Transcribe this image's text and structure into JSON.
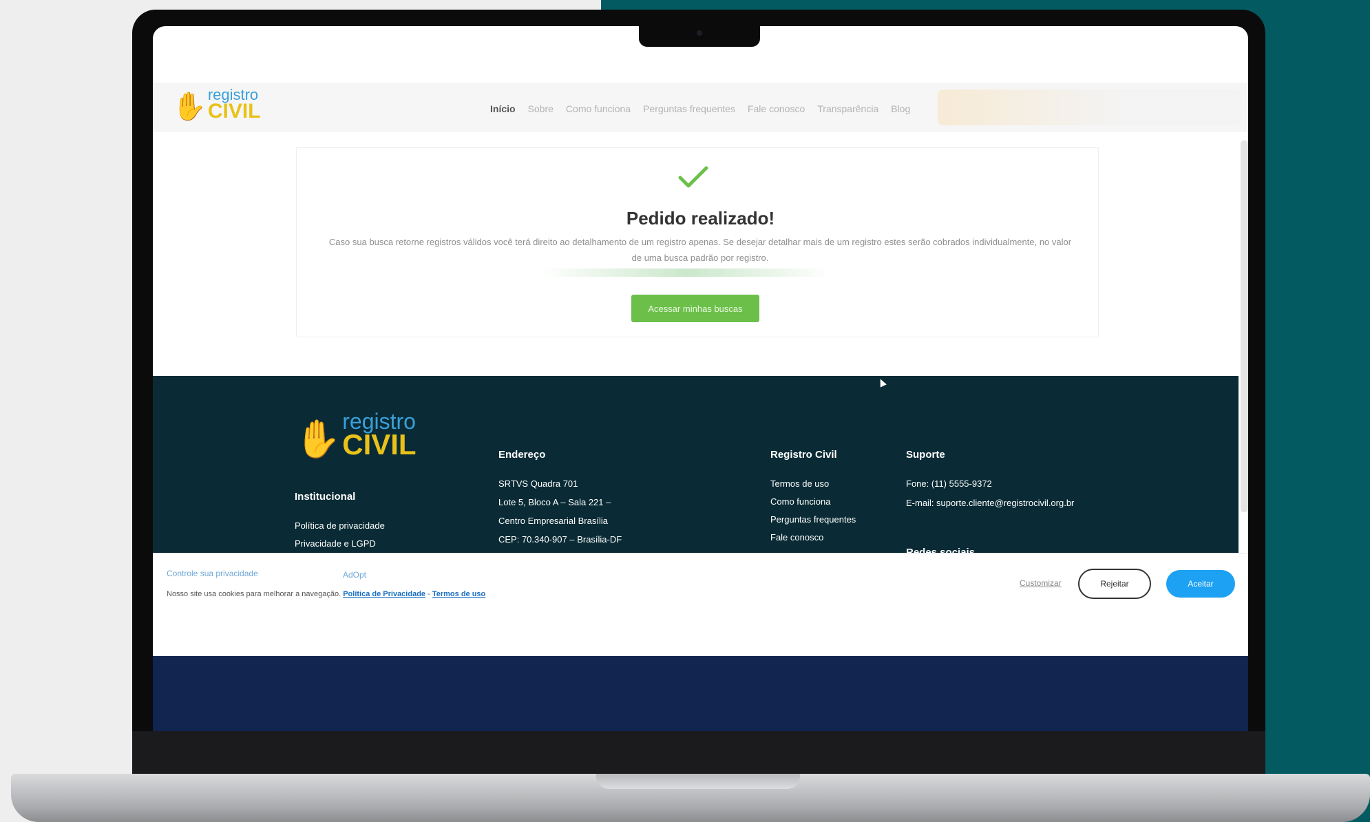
{
  "header": {
    "logo_top": "registro",
    "logo_bottom": "CIVIL",
    "nav": [
      "Início",
      "Sobre",
      "Como funciona",
      "Perguntas frequentes",
      "Fale conosco",
      "Transparência",
      "Blog"
    ]
  },
  "card": {
    "title": "Pedido realizado!",
    "text": "Caso sua busca retorne registros válidos você terá direito ao detalhamento de um registro apenas. Se desejar detalhar mais de um registro estes serão cobrados individualmente, no valor de uma busca padrão por registro.",
    "button": "Acessar minhas buscas"
  },
  "footer": {
    "logo_top": "registro",
    "logo_bottom": "CIVIL",
    "institucional": {
      "title": "Institucional",
      "items": [
        "Política de privacidade",
        "Privacidade e LGPD"
      ]
    },
    "endereco": {
      "title": "Endereço",
      "lines": [
        "SRTVS Quadra 701",
        "Lote 5, Bloco A – Sala 221 –",
        "Centro Empresarial Brasília",
        "CEP: 70.340-907 – Brasília-DF"
      ]
    },
    "registro_civil": {
      "title": "Registro Civil",
      "items": [
        "Termos de uso",
        "Como funciona",
        "Perguntas frequentes",
        "Fale conosco"
      ]
    },
    "suporte": {
      "title": "Suporte",
      "phone": "Fone: (11) 5555-9372",
      "email": "E-mail: suporte.cliente@registrocivil.org.br",
      "social": "Redes sociais"
    }
  },
  "cookie": {
    "title": "Controle sua privacidade",
    "powered": "AdOpt",
    "text": "Nosso site usa cookies para melhorar a navegação.",
    "privacy_link": "Política de Privacidade",
    "separator": "-",
    "terms_link": "Termos de uso",
    "customize": "Customizar",
    "reject": "Rejeitar",
    "accept": "Aceitar"
  }
}
